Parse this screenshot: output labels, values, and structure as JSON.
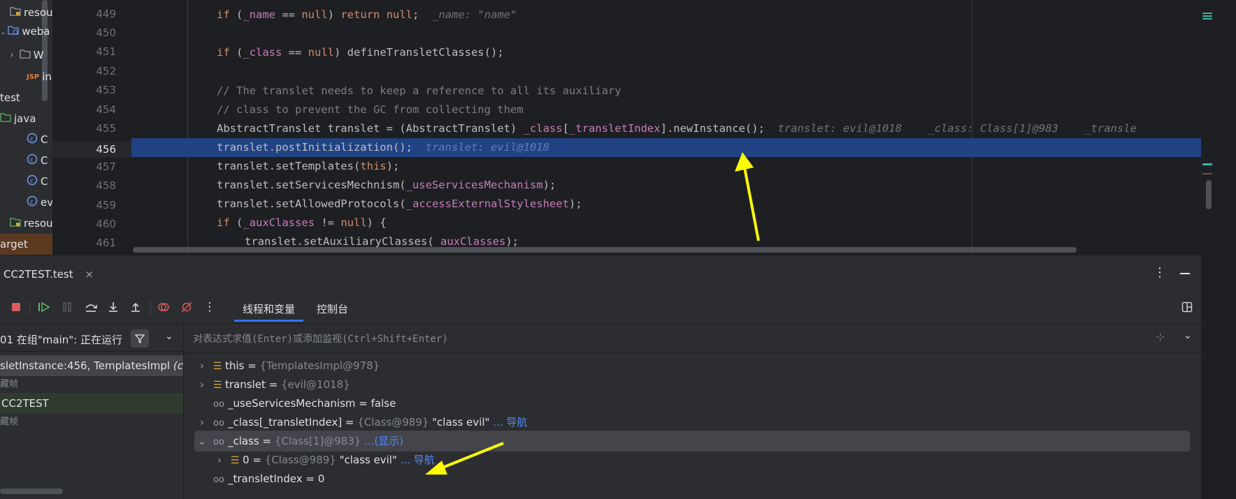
{
  "tree": {
    "items": [
      {
        "label": "resou",
        "icon": "resource-folder-icon"
      },
      {
        "label": "weba",
        "icon": "web-folder-icon"
      },
      {
        "label": "W",
        "icon": "folder-icon"
      },
      {
        "label": "in",
        "icon": "jsp-file-icon",
        "icon_text": "JSP"
      },
      {
        "label": "test",
        "icon": "chevron-down-icon"
      },
      {
        "label": "java",
        "icon": "test-folder-icon"
      },
      {
        "label": "C",
        "icon": "class-icon"
      },
      {
        "label": "C",
        "icon": "class-icon"
      },
      {
        "label": "C",
        "icon": "class-icon"
      },
      {
        "label": "ev",
        "icon": "class-icon"
      },
      {
        "label": "resou",
        "icon": "resource-folder-icon"
      },
      {
        "label": "arget",
        "icon": "folder-icon"
      }
    ]
  },
  "editor": {
    "line_numbers": [
      "449",
      "450",
      "451",
      "452",
      "453",
      "454",
      "455",
      "456",
      "457",
      "458",
      "459",
      "460",
      "461"
    ],
    "current_line": "456",
    "inline_hints": {
      "l449": "_name: \"name\"",
      "l455a": "translet: evil@1018",
      "l455b": "_class: Class[1]@983",
      "l455c": "_transle",
      "l456": "translet: evil@1018"
    }
  },
  "debug": {
    "session_tab": "CC2TEST.test",
    "sub_tabs": [
      "线程和变量",
      "控制台"
    ],
    "thread_text": "01 在组\"main\": 正在运行",
    "eval_placeholder": "对表达式求值(Enter)或添加监视(Ctrl+Shift+Enter)",
    "frames": [
      {
        "text": "sletInstance:456, TemplatesImpl",
        "italic": "(co"
      },
      {
        "text": "藏帧",
        "italic": ""
      },
      {
        "text": "CC2TEST",
        "italic": ""
      },
      {
        "text": "藏帧",
        "italic": ""
      }
    ],
    "variables": [
      {
        "expand": "›",
        "icon": "field-icon",
        "name": "this",
        "eq": " = ",
        "type": "{TemplatesImpl@978}",
        "value": "",
        "link": ""
      },
      {
        "expand": "›",
        "icon": "field-icon",
        "name": "translet",
        "eq": " = ",
        "type": "{evil@1018}",
        "value": "",
        "link": ""
      },
      {
        "expand": "",
        "icon": "watch-icon",
        "name": "_useServicesMechanism",
        "eq": " = ",
        "type": "",
        "value": "false",
        "link": ""
      },
      {
        "expand": "›",
        "icon": "watch-icon",
        "name": "_class[_transletIndex]",
        "eq": " = ",
        "type": "{Class@989}",
        "value": " \"class evil\"",
        "link": " ... 导航"
      },
      {
        "expand": "⌄",
        "icon": "watch-icon",
        "name": "_class",
        "eq": " = ",
        "type": "{Class[1]@983}",
        "value": "",
        "link": " ...(显示)"
      },
      {
        "expand": "›",
        "icon": "field-icon",
        "name": "0",
        "eq": " = ",
        "type": "{Class@989}",
        "value": " \"class evil\"",
        "link": " ... 导航"
      },
      {
        "expand": "",
        "icon": "watch-icon",
        "name": "_transletIndex",
        "eq": " = ",
        "type": "",
        "value": "0",
        "link": ""
      }
    ]
  },
  "colors": {
    "accent": "#3574f0",
    "highlight_line": "#214283",
    "annotation_arrow": "#ffff00"
  }
}
